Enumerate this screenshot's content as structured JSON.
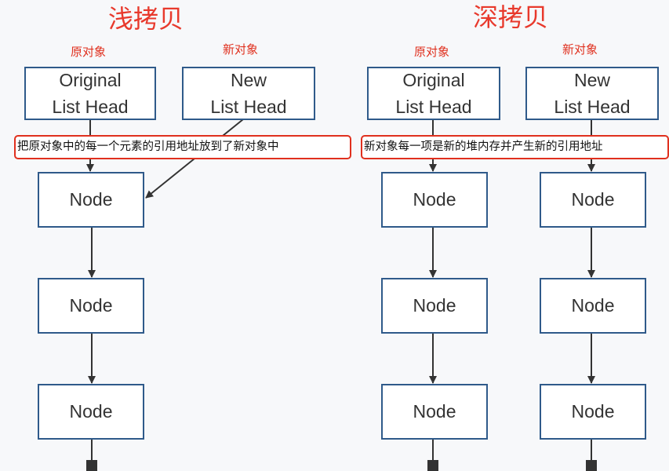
{
  "shallow": {
    "title": "浅拷贝",
    "original_caption": "原对象",
    "new_caption": "新对象",
    "original_head": [
      "Original",
      "List Head"
    ],
    "new_head": [
      "New",
      "List Head"
    ],
    "note": "把原对象中的每一个元素的引用地址放到了新对象中",
    "nodes": [
      "Node",
      "Node",
      "Node"
    ]
  },
  "deep": {
    "title": "深拷贝",
    "original_caption": "原对象",
    "new_caption": "新对象",
    "original_head": [
      "Original",
      "List Head"
    ],
    "new_head": [
      "New",
      "List Head"
    ],
    "note": "新对象每一项是新的堆内存并产生新的引用地址",
    "original_nodes": [
      "Node",
      "Node",
      "Node"
    ],
    "new_nodes": [
      "Node",
      "Node",
      "Node"
    ]
  },
  "colors": {
    "title_red": "#e8392c",
    "box_border": "#2f5a8a",
    "arrow": "#333333",
    "note_border": "#e0301e"
  }
}
